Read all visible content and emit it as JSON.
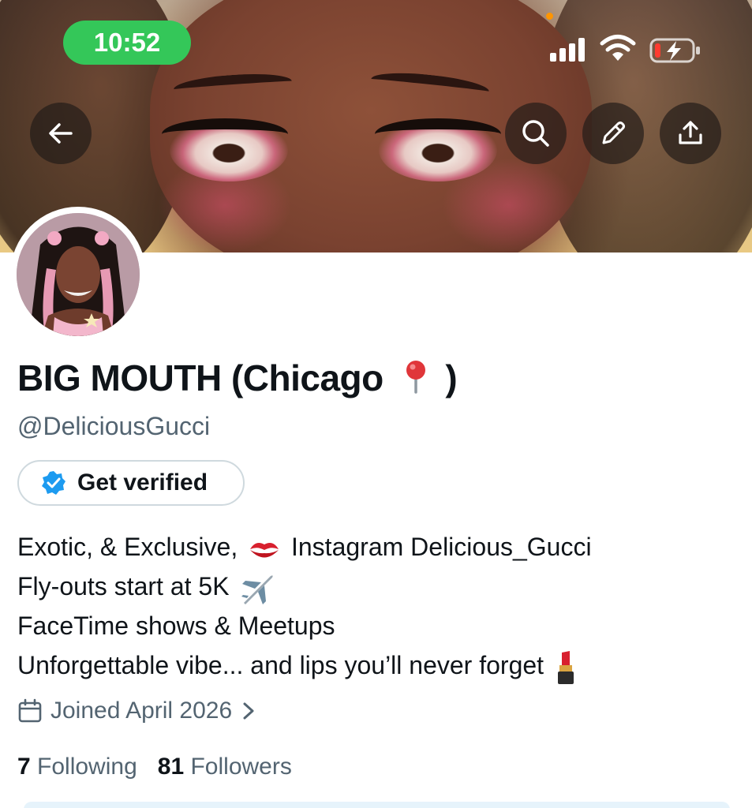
{
  "status_bar": {
    "time": "10:52"
  },
  "header": {
    "back_icon": "arrow-left-icon",
    "search_icon": "search-icon",
    "edit_icon": "pencil-icon",
    "share_icon": "share-upload-icon"
  },
  "profile": {
    "display_name": "BIG MOUTH (Chicago 📍)",
    "name_prefix": "BIG MOUTH (Chicago",
    "name_suffix": ")",
    "handle": "@DeliciousGucci",
    "verify_label": "Get verified",
    "bio_lines": [
      "Exotic, & Exclusive, 💋 Instagram Delicious_Gucci",
      "Fly-outs start at 5K ✈️",
      "FaceTime shows & Meetups",
      "Unforgettable vibe... and lips you’ll never forget 💄"
    ],
    "bio": {
      "line1_a": "Exotic, & Exclusive,",
      "line1_b": "Instagram Delicious_Gucci",
      "line2": "Fly-outs start at 5K",
      "line3": "FaceTime shows & Meetups",
      "line4": "Unforgettable vibe... and lips you’ll never forget"
    },
    "joined": "Joined April 2026",
    "following_count": "7",
    "following_label": "Following",
    "followers_count": "81",
    "followers_label": "Followers"
  },
  "colors": {
    "status_pill": "#34c759",
    "verified_blue": "#1d9bf0",
    "secondary_text": "#536471",
    "primary_text": "#0f1419"
  }
}
